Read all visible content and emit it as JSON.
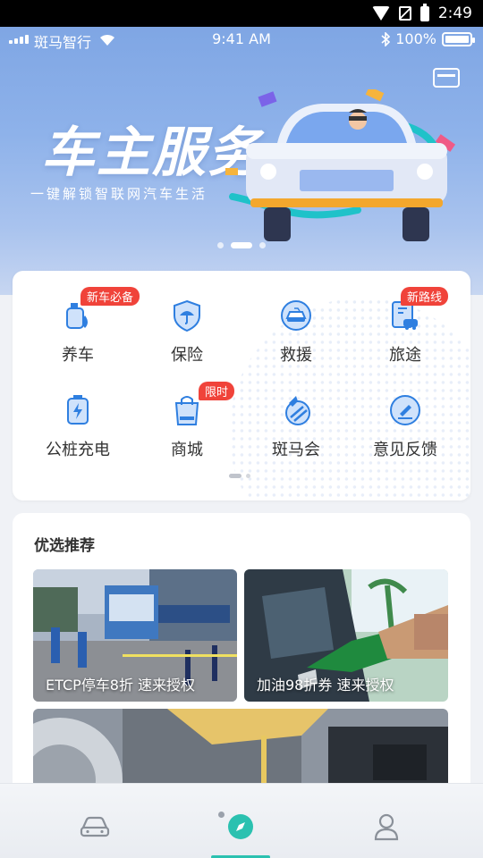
{
  "android_status": {
    "time": "2:49"
  },
  "ios_status": {
    "carrier": "斑马智行",
    "time": "9:41 AM",
    "battery": "100%"
  },
  "banner": {
    "title": "车主服务",
    "subtitle": "一键解锁智联网汽车生活",
    "active_slide": 1,
    "slide_count": 3
  },
  "services": [
    {
      "label": "养车",
      "badge": "新车必备",
      "icon": "car-care-icon"
    },
    {
      "label": "保险",
      "badge": "",
      "icon": "insurance-umbrella-icon"
    },
    {
      "label": "救援",
      "badge": "",
      "icon": "rescue-car-icon"
    },
    {
      "label": "旅途",
      "badge": "新路线",
      "icon": "trip-icon"
    },
    {
      "label": "公桩充电",
      "badge": "",
      "icon": "charging-icon"
    },
    {
      "label": "商城",
      "badge": "限时",
      "icon": "shopping-bag-icon"
    },
    {
      "label": "斑马会",
      "badge": "",
      "icon": "zebra-club-icon"
    },
    {
      "label": "意见反馈",
      "badge": "",
      "icon": "feedback-icon"
    }
  ],
  "recommend": {
    "title": "优选推荐",
    "items": [
      {
        "caption": "ETCP停车8折  速来授权"
      },
      {
        "caption": "加油98折券  速来授权"
      },
      {
        "caption": ""
      }
    ]
  },
  "nav": {
    "items": [
      "car-icon",
      "compass-icon",
      "profile-icon"
    ],
    "active_index": 1
  },
  "colors": {
    "accent": "#2bc1b0",
    "badge": "#f0433a",
    "icon_blue": "#2f7fe0"
  }
}
